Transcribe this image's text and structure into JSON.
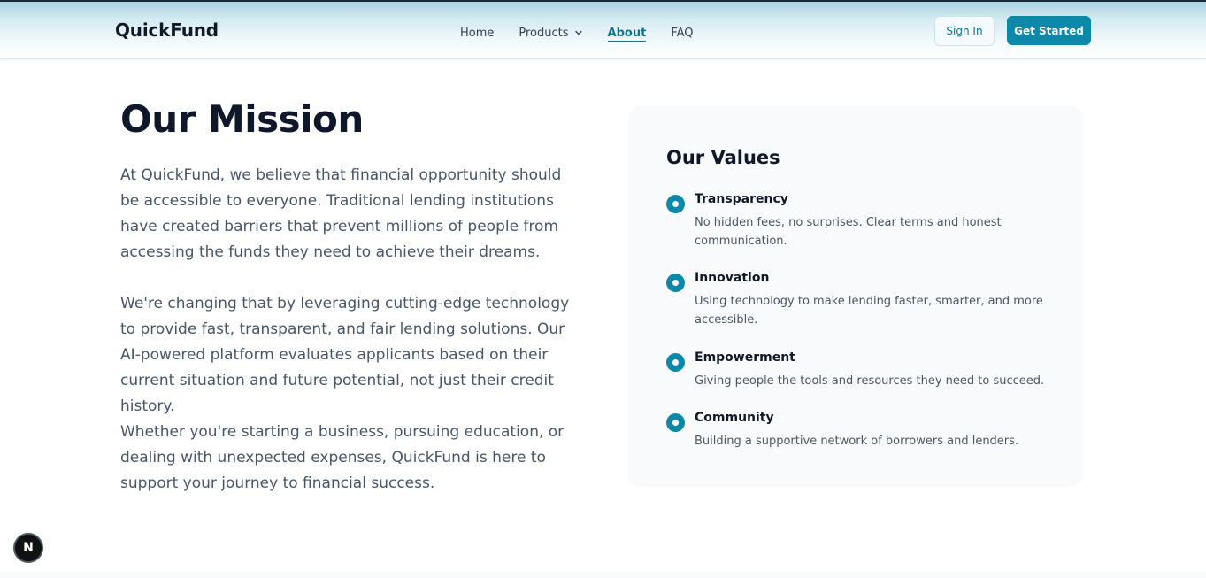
{
  "header": {
    "logo": "QuickFund",
    "nav": {
      "home": "Home",
      "products": "Products",
      "about": "About",
      "faq": "FAQ"
    },
    "sign_in": "Sign In",
    "get_started": "Get Started"
  },
  "mission": {
    "title": "Our Mission",
    "paragraphs": [
      "At QuickFund, we believe that financial opportunity should be accessible to everyone. Traditional lending institutions have created barriers that prevent millions of people from accessing the funds they need to achieve their dreams.",
      "We're changing that by leveraging cutting-edge technology to provide fast, transparent, and fair lending solutions. Our AI-powered platform evaluates applicants based on their current situation and future potential, not just their credit history.",
      "Whether you're starting a business, pursuing education, or dealing with unexpected expenses, QuickFund is here to support your journey to financial success."
    ]
  },
  "values": {
    "title": "Our Values",
    "items": [
      {
        "title": "Transparency",
        "description": "No hidden fees, no surprises. Clear terms and honest communication."
      },
      {
        "title": "Innovation",
        "description": "Using technology to make lending faster, smarter, and more accessible."
      },
      {
        "title": "Empowerment",
        "description": "Giving people the tools and resources they need to succeed."
      },
      {
        "title": "Community",
        "description": "Building a supportive network of borrowers and lenders."
      }
    ]
  },
  "floating_badge": "N",
  "colors": {
    "accent": "#0e88a8",
    "active_nav": "#0e7490",
    "heading": "#0f172a",
    "body_text": "#475569",
    "card_bg": "#f8fafc"
  },
  "icons": {
    "products_dropdown": "chevron-down-icon",
    "value_bullet": "circle-dot-icon"
  }
}
